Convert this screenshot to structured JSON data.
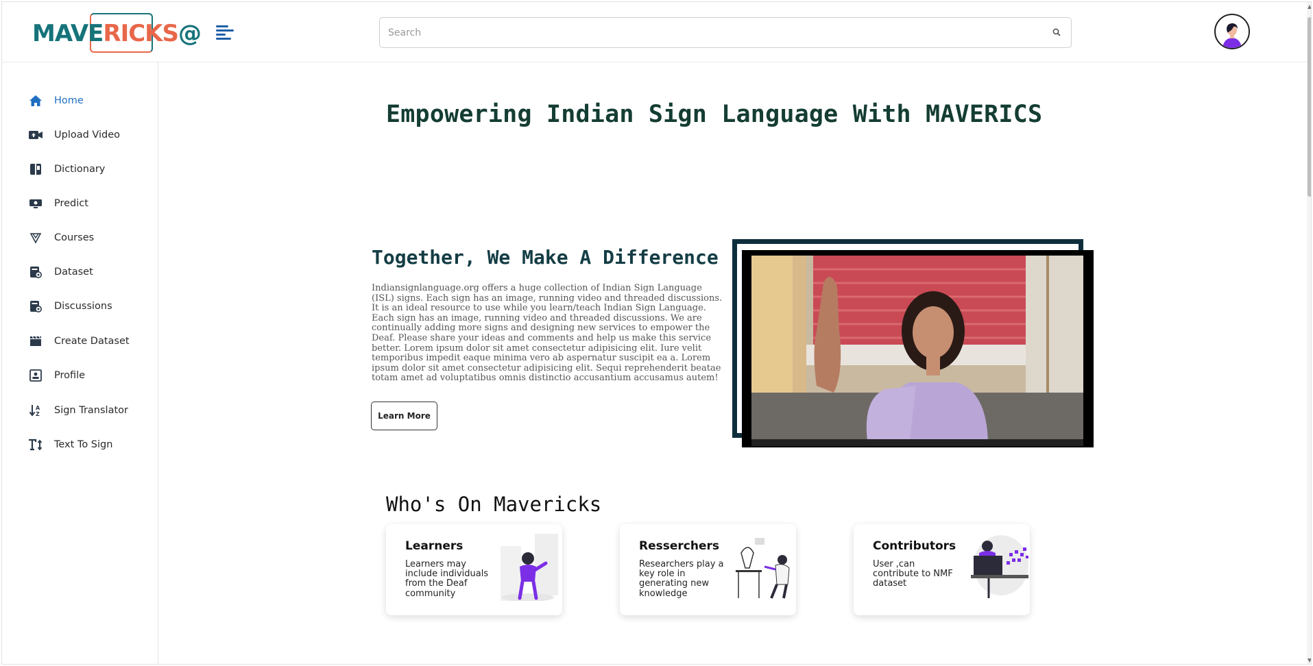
{
  "header": {
    "logo_text_a": "MAVE",
    "logo_text_b": "RICKS",
    "logo_text_c": "@",
    "search_placeholder": "Search",
    "search_value": ""
  },
  "sidebar": {
    "items": [
      {
        "label": "Home",
        "icon": "home-icon",
        "active": true
      },
      {
        "label": "Upload Video",
        "icon": "video-upload-icon"
      },
      {
        "label": "Dictionary",
        "icon": "book-icon"
      },
      {
        "label": "Predict",
        "icon": "predict-icon"
      },
      {
        "label": "Courses",
        "icon": "courses-icon"
      },
      {
        "label": "Dataset",
        "icon": "dataset-icon"
      },
      {
        "label": "Discussions",
        "icon": "discussions-icon"
      },
      {
        "label": "Create Dataset",
        "icon": "clapper-icon"
      },
      {
        "label": "Profile",
        "icon": "profile-icon"
      },
      {
        "label": "Sign Translator",
        "icon": "sort-az-icon"
      },
      {
        "label": "Text To Sign",
        "icon": "text-size-icon"
      }
    ]
  },
  "main": {
    "hero_title": "Empowering Indian Sign Language With MAVERICS",
    "section_title": "Together, We Make A Difference",
    "section_text": "Indiansignlanguage.org offers a huge collection of Indian Sign Language (ISL) signs. Each sign has an image, running video and threaded discussions. It is an ideal resource to use while you learn/teach Indian Sign Language. Each sign has an image, running video and threaded discussions. We are continually adding more signs and designing new services to empower the Deaf. Please share your ideas and comments and help us make this service better. Lorem ipsum dolor sit amet consectetur adipisicing elit. Iure velit temporibus impedit eaque minima vero ab aspernatur suscipit ea a. Lorem ipsum dolor sit amet consectetur adipisicing elit. Sequi reprehenderit beatae totam amet ad voluptatibus omnis distinctio accusantium accusamus autem!",
    "learn_more_label": "Learn More",
    "who_title": "Who's On Mavericks",
    "cards": [
      {
        "title": "Learners",
        "desc": "Learners may include individuals from the Deaf community"
      },
      {
        "title": "Resserchers",
        "desc": "Researchers play a key role in generating new knowledge"
      },
      {
        "title": "Contributors",
        "desc": "User ,can contribute to NMF dataset"
      }
    ]
  },
  "colors": {
    "accent_blue": "#1f6fc0",
    "title_dark": "#143d33",
    "logo_teal": "#16737a",
    "logo_orange": "#e8674a",
    "illustration_purple": "#7b2ee6"
  }
}
